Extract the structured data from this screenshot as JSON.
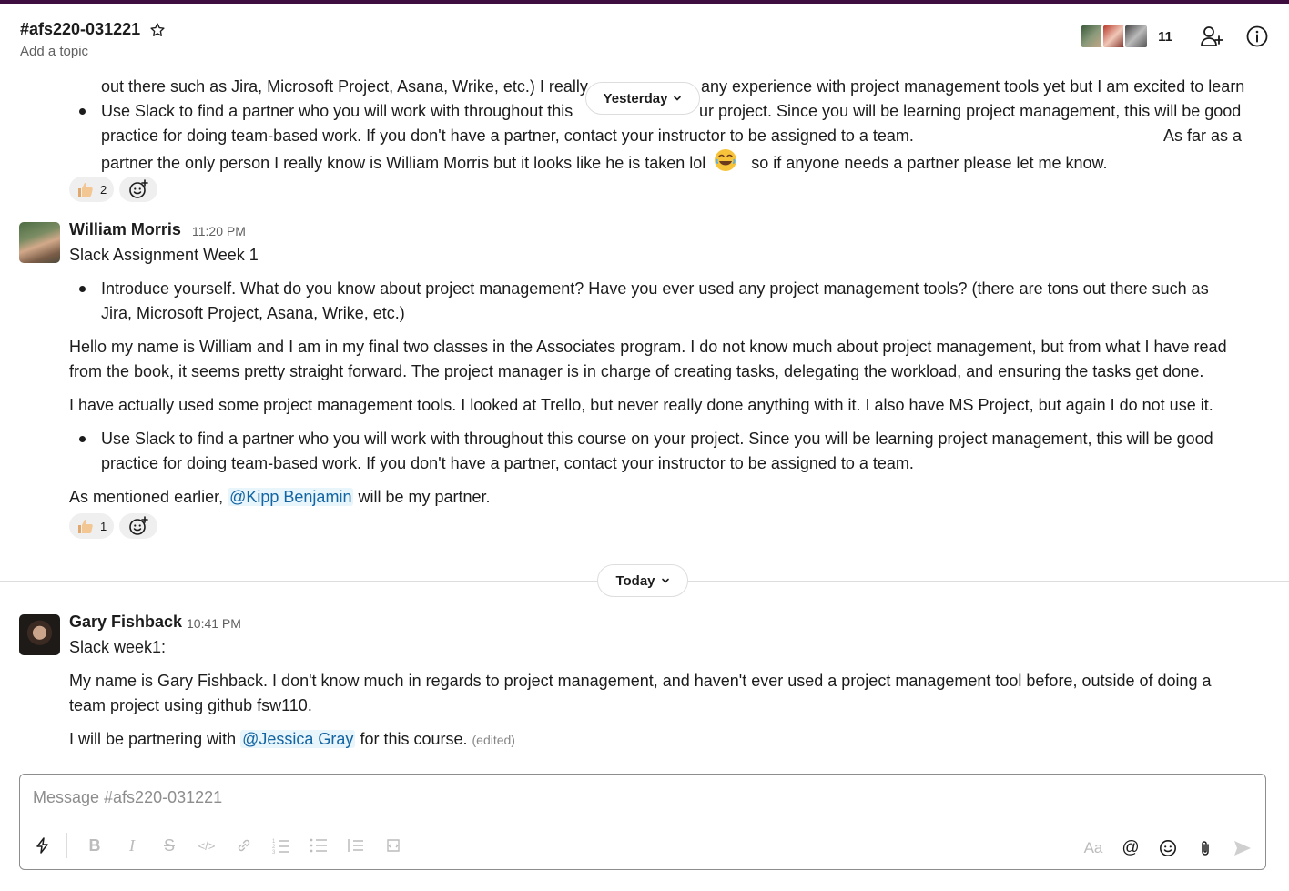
{
  "header": {
    "channel_name": "#afs220-031221",
    "topic": "Add a topic",
    "member_count": "11"
  },
  "messages_prev": {
    "line1_a": "out there such as Jira, Microsoft Project, Asana, Wrike, etc.) I really",
    "line1_b": "any experience with project management tools yet but I am excited to learn",
    "line2_a": "Use Slack to find a partner who you will work with throughout this",
    "line2_b": "ur project. Since you will be learning project management, this will be good",
    "line3_a": "practice for doing team-based work. If you don't have a partner, contact your instructor to be assigned to a team.",
    "line3_b": "As far as a",
    "line4_a": "partner the only person I really know is William Morris but it looks like he is taken lol",
    "line4_b": "so if anyone needs a partner please let me know.",
    "reaction_count": "2"
  },
  "pill_yesterday": "Yesterday",
  "pill_today": "Today",
  "msg_william": {
    "sender": "William Morris",
    "time": "11:20 PM",
    "title": "Slack Assignment Week 1",
    "b1_l1": "Introduce yourself. What do you know about project management? Have you ever used any project management tools? (there are tons out there such as",
    "b1_l2": "Jira, Microsoft Project, Asana, Wrike, etc.)",
    "p1_l1": "Hello my name is William and I am in my final two classes in the Associates program. I do not know much about project management, but from what I have read",
    "p1_l2": "from the book, it seems pretty straight forward. The project manager is in charge of  creating tasks, delegating the workload, and ensuring the tasks get done.",
    "p2": "I have actually used some project management tools. I looked at Trello, but never really done anything with it. I also have MS Project, but again I do not use it.",
    "b2_l1": "Use Slack to find a partner who you will work with throughout this course on your project. Since you will be learning project management, this will be good",
    "b2_l2": "practice for doing team-based work. If you don't have a partner, contact your instructor to be assigned to a team.",
    "p3_pre": "As mentioned earlier,",
    "p3_mention": "@Kipp Benjamin",
    "p3_post": "will be my partner.",
    "reaction_count": "1"
  },
  "msg_gary": {
    "sender": "Gary Fishback",
    "time": "10:41 PM",
    "title": "Slack week1:",
    "p1_l1": "My name is Gary Fishback. I don't know much in regards to project management, and haven't ever used a project management tool before, outside of doing a",
    "p1_l2": "team project using github  fsw110.",
    "p2_pre": "I will be partnering with",
    "p2_mention": "@Jessica Gray",
    "p2_post": "for this course.",
    "edited": "(edited)"
  },
  "composer": {
    "placeholder": "Message #afs220-031221",
    "format_label": "Aa"
  },
  "colors": {
    "aubergine": "#3f0e40",
    "mention_text": "#1264a3",
    "mention_bg": "#e8f5fa"
  }
}
